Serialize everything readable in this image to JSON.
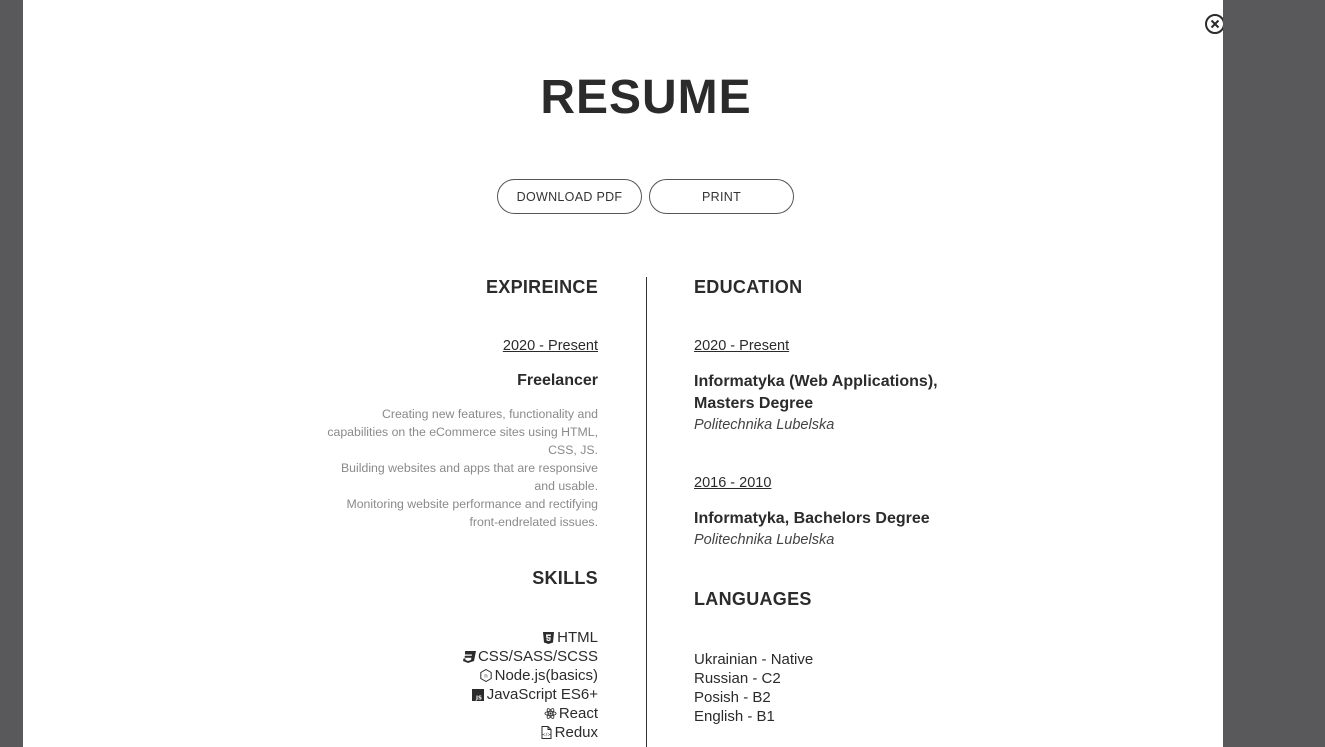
{
  "modal": {
    "title": "RESUME",
    "download_label": "DOWNLOAD PDF",
    "print_label": "PRINT",
    "close_icon": "close-circle-icon"
  },
  "experience": {
    "heading": "EXPIREINCE",
    "items": [
      {
        "date": "2020 - Present",
        "role": "Freelancer",
        "description": [
          "Creating new features, functionality and",
          "capabilities on the eCommerce sites using HTML,",
          "CSS, JS.",
          "Building websites and apps that are responsive",
          "and usable.",
          "Monitoring website performance and rectifying",
          "front-endrelated issues."
        ]
      }
    ]
  },
  "skills": {
    "heading": "SKILLS",
    "items": [
      {
        "label": "HTML",
        "icon": "html5-icon"
      },
      {
        "label": "CSS/SASS/SCSS",
        "icon": "css3-icon"
      },
      {
        "label": "Node.js(basics)",
        "icon": "nodejs-icon"
      },
      {
        "label": "JavaScript ES6+",
        "icon": "javascript-icon"
      },
      {
        "label": "React",
        "icon": "react-icon"
      },
      {
        "label": "Redux",
        "icon": "redux-icon"
      }
    ]
  },
  "education": {
    "heading": "EDUCATION",
    "items": [
      {
        "date": "2020 - Present",
        "degree_line1": "Informatyka (Web Applications),",
        "degree_line2": "Masters Degree",
        "school": "Politechnika Lubelska"
      },
      {
        "date": "2016 - 2010",
        "degree_line1": "Informatyka, Bachelors Degree",
        "school": "Politechnika Lubelska"
      }
    ]
  },
  "languages": {
    "heading": "LANGUAGES",
    "items": [
      "Ukrainian - Native",
      "Russian - C2",
      "Posish - B2",
      "English - B1"
    ]
  }
}
